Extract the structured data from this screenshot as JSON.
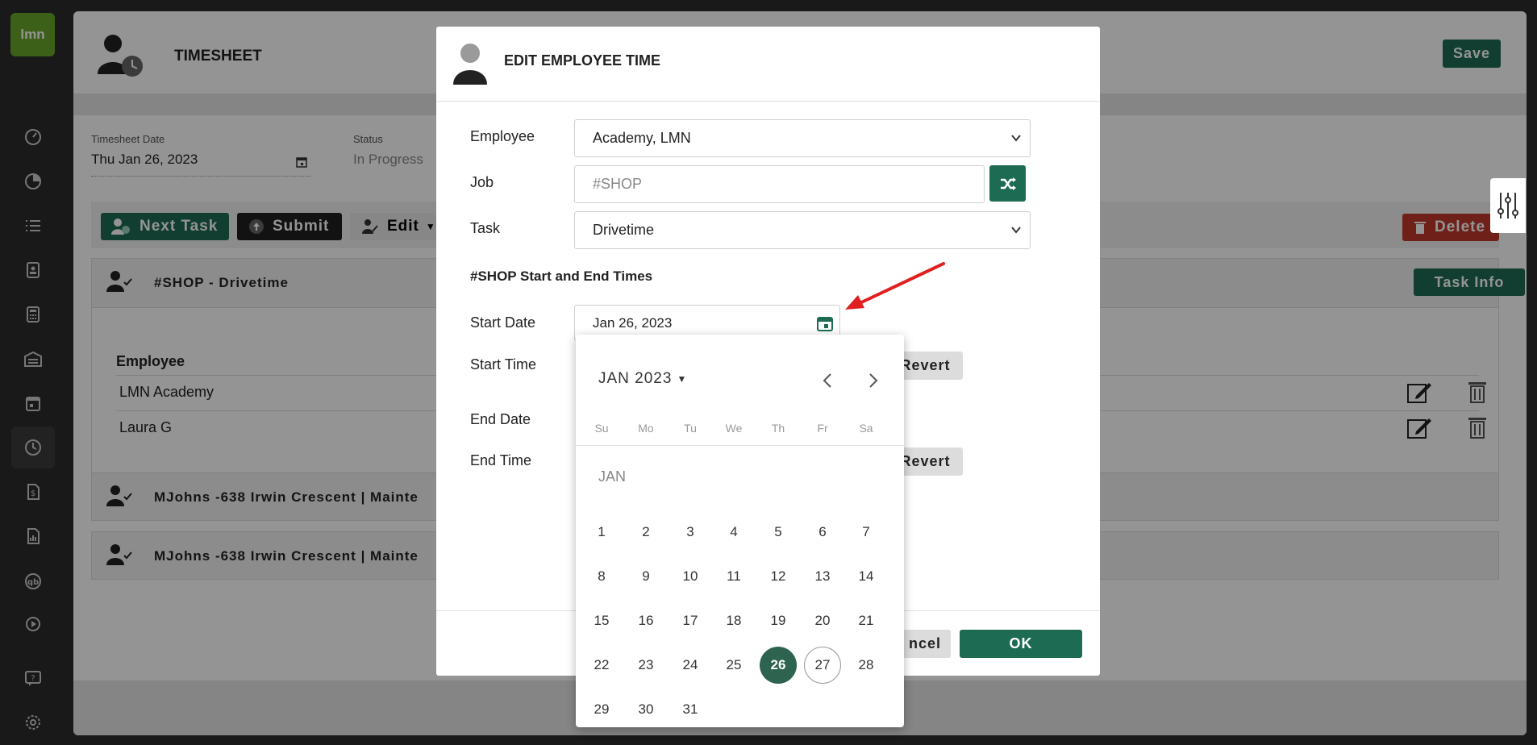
{
  "sidebar": {
    "logo": "lmn",
    "items": [
      {
        "icon": "dashboard-icon"
      },
      {
        "icon": "pie-chart-icon"
      },
      {
        "icon": "list-icon"
      },
      {
        "icon": "contact-card-icon"
      },
      {
        "icon": "calculator-icon"
      },
      {
        "icon": "warehouse-icon"
      },
      {
        "icon": "calendar-icon"
      },
      {
        "icon": "clock-icon"
      },
      {
        "icon": "invoice-icon"
      },
      {
        "icon": "report-icon"
      },
      {
        "icon": "quickbooks-icon"
      },
      {
        "icon": "play-icon"
      },
      {
        "icon": "help-icon"
      },
      {
        "icon": "settings-icon"
      }
    ]
  },
  "timesheet": {
    "title": "TIMESHEET",
    "save_label": "Save",
    "date_label": "Timesheet Date",
    "date_value": "Thu Jan 26, 2023",
    "status_label": "Status",
    "status_value": "In Progress",
    "toolbar": {
      "next_task": "Next Task",
      "submit": "Submit",
      "edit": "Edit",
      "delete": "Delete"
    },
    "tasks": [
      {
        "title": "#SHOP - Drivetime",
        "info_label": "Task Info"
      },
      {
        "title": "MJohns -638 Irwin Crescent | Mainte"
      },
      {
        "title": "MJohns -638 Irwin Crescent | Mainte"
      }
    ],
    "employee_header": "Employee",
    "employees": [
      "LMN Academy",
      "Laura G"
    ]
  },
  "modal": {
    "title": "EDIT EMPLOYEE TIME",
    "employee_label": "Employee",
    "employee_value": "Academy, LMN",
    "job_label": "Job",
    "job_placeholder": "#SHOP",
    "task_label": "Task",
    "task_value": "Drivetime",
    "section_title": "#SHOP Start and End Times",
    "start_date_label": "Start Date",
    "start_date_value": "Jan 26, 2023",
    "start_time_label": "Start Time",
    "end_date_label": "End Date",
    "end_time_label": "End Time",
    "revert_label": "Revert",
    "cancel_label": "ncel",
    "ok_label": "OK"
  },
  "calendar": {
    "month_year": "JAN 2023",
    "weekdays": [
      "Su",
      "Mo",
      "Tu",
      "We",
      "Th",
      "Fr",
      "Sa"
    ],
    "month_label": "JAN",
    "days": [
      "1",
      "2",
      "3",
      "4",
      "5",
      "6",
      "7",
      "8",
      "9",
      "10",
      "11",
      "12",
      "13",
      "14",
      "15",
      "16",
      "17",
      "18",
      "19",
      "20",
      "21",
      "22",
      "23",
      "24",
      "25",
      "26",
      "27",
      "28",
      "29",
      "30",
      "31"
    ],
    "selected_day": 26,
    "today_day": 27,
    "selected_color": "#2e6350"
  },
  "colors": {
    "accent": "#1e6b53",
    "delete": "#c0392b",
    "annotation_arrow": "#e02020"
  }
}
